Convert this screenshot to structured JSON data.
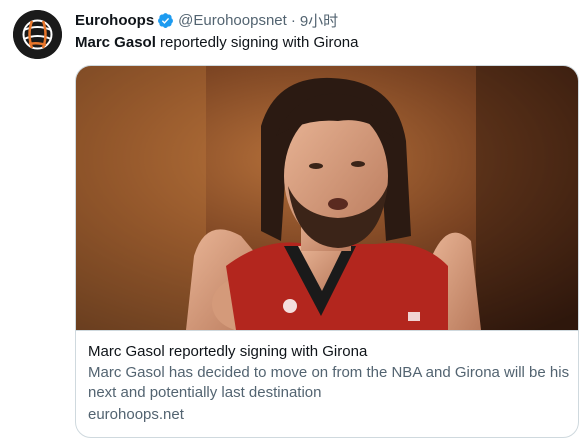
{
  "author": {
    "name": "Eurohoops",
    "handle": "@Eurohoopsnet",
    "separator": "·",
    "time": "9小时",
    "avatar_icon": "eurohoops-basketball-logo",
    "verified_icon": "verified-badge-icon",
    "verified_color": "#1d9bf0"
  },
  "tweet": {
    "bold_text": "Marc Gasol",
    "rest_text": " reportedly signing with Girona"
  },
  "card": {
    "image": "photo-basketball-player-red-black-jersey",
    "title": "Marc Gasol reportedly signing with Girona",
    "description": "Marc Gasol has decided to move on from the NBA and Girona will be his next and potentially last destination",
    "domain": "eurohoops.net"
  }
}
